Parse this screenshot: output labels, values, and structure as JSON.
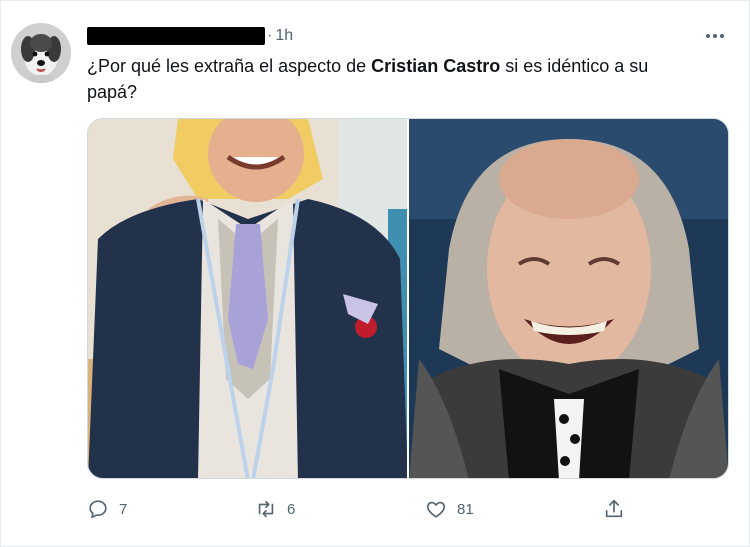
{
  "tweet": {
    "time": "1h",
    "separator": "·",
    "text_parts": {
      "before": "¿Por qué les extraña el aspecto de ",
      "bold": "Cristian Castro",
      "after": " si es idéntico a su papá?"
    },
    "media": [
      {
        "subject": "man in navy suit with lavender paisley tie"
      },
      {
        "subject": "laughing elderly man with long gray hair and skull tie"
      }
    ]
  },
  "actions": {
    "reply": {
      "icon": "reply-icon",
      "count": "7"
    },
    "retweet": {
      "icon": "retweet-icon",
      "count": "6"
    },
    "like": {
      "icon": "heart-icon",
      "count": "81"
    },
    "share": {
      "icon": "share-icon"
    }
  },
  "colors": {
    "text": "#0f1419",
    "secondary": "#536471",
    "border": "#cfd9de"
  }
}
